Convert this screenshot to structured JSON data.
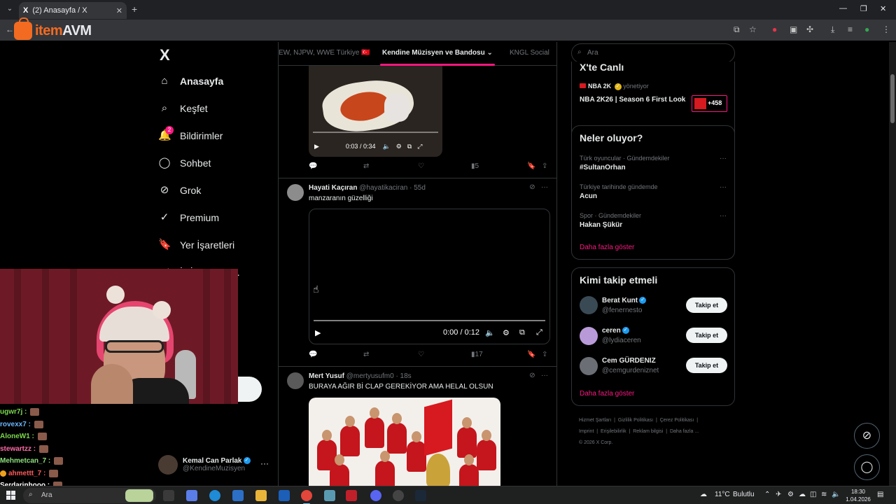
{
  "browser": {
    "tab_title": "(2) Anasayfa / X",
    "tab_favicon": "X",
    "logo_part1": "item",
    "logo_part2": "AVM"
  },
  "nav": {
    "x_logo": "X",
    "items": [
      {
        "label": "Anasayfa",
        "icon": "home-icon",
        "glyph": "⌂"
      },
      {
        "label": "Keşfet",
        "icon": "search-icon",
        "glyph": "⌕"
      },
      {
        "label": "Bildirimler",
        "icon": "bell-icon",
        "glyph": "🔔",
        "badge": "2"
      },
      {
        "label": "Sohbet",
        "icon": "chat-icon",
        "glyph": "◯"
      },
      {
        "label": "Grok",
        "icon": "grok-icon",
        "glyph": "⊘"
      },
      {
        "label": "Premium",
        "icon": "premium-icon",
        "glyph": "✓"
      },
      {
        "label": "Yer İşaretleri",
        "icon": "bookmark-icon",
        "glyph": "🔖"
      },
      {
        "label": "İş İlanları St...",
        "icon": "jobs-icon",
        "glyph": "◁"
      }
    ],
    "profile": {
      "name": "Kemal Can Parlak",
      "handle": "@KendineMuzisyen"
    }
  },
  "feed": {
    "tabs": [
      "EW, NJPW, WWE Türkiye 🇹🇷",
      "Kendine Müzisyen ve Bandosu",
      "KNGL Social"
    ],
    "video1": {
      "time": "0:03 / 0:34"
    },
    "post1_actions": {
      "views": "5"
    },
    "post2": {
      "name": "Hayati Kaçıran",
      "meta": "@hayatikaciran · 55d",
      "text": "manzaranın güzelliği",
      "video_time": "0:00 / 0:12",
      "views": "17"
    },
    "post3": {
      "name": "Mert Yusuf",
      "meta": "@mertyusufm0 · 18s",
      "text": "BURAYA AĞIR Bİ CLAP GEREKİYOR AMA HELAL OLSUN"
    }
  },
  "right": {
    "search_placeholder": "Ara",
    "live": {
      "title": "X'te Canlı",
      "host": "NBA 2K",
      "host_role": "yönetiyor",
      "stream_title": "NBA 2K26 | Season 6 First Look",
      "count": "+458"
    },
    "trends": {
      "title": "Neler oluyor?",
      "items": [
        {
          "meta": "Türk oyuncular · Gündemdekiler",
          "name": "#SultanOrhan"
        },
        {
          "meta": "Türkiye tarihinde gündemde",
          "name": "Acun"
        },
        {
          "meta": "Spor · Gündemdekiler",
          "name": "Hakan Şükür"
        }
      ],
      "more": "Daha fazla göster"
    },
    "who_to_follow": {
      "title": "Kimi takip etmeli",
      "users": [
        {
          "name": "Berat Kunt",
          "handle": "@fenernesto",
          "button": "Takip et"
        },
        {
          "name": "ceren",
          "handle": "@lydiaceren",
          "button": "Takip et"
        },
        {
          "name": "Cem GÜRDENIZ",
          "handle": "@cemgurdeniznet",
          "button": "Takip et"
        }
      ],
      "more": "Daha fazla göster"
    },
    "footer": [
      "Hizmet Şartları",
      "Gizlilik Politikası",
      "Çerez Politikası",
      "Imprint",
      "Erişilebilirlik",
      "Reklam bilgisi",
      "Daha fazla ...",
      "© 2026 X Corp."
    ]
  },
  "chat": [
    {
      "user": "ugwr7j :",
      "color": "#7cd94c"
    },
    {
      "user": "rovexx7 :",
      "color": "#6ab7ff"
    },
    {
      "user": "AloneW1 :",
      "color": "#7cd94c"
    },
    {
      "user": "stewartzz :",
      "color": "#ff6aa6"
    },
    {
      "user": "Mehmetcan_7 :",
      "color": "#8de07c"
    },
    {
      "user": "ahmettt_7 :",
      "color": "#ff5a5a"
    },
    {
      "user": "Serdarinhooo :",
      "color": "#ffffff"
    }
  ],
  "taskbar": {
    "search": "Ara",
    "weather": "11°C",
    "weather_text": "Bulutlu",
    "time": "18:30",
    "date": "1.04.2026"
  }
}
